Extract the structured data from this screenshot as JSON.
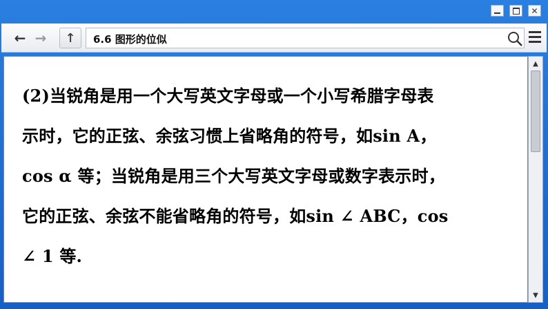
{
  "window": {
    "controls": {
      "minimize": "▭",
      "maximize": "□",
      "close": "✕"
    }
  },
  "toolbar": {
    "back_icon": "←",
    "forward_icon": "→",
    "up_icon": "↑",
    "address": "6.6 图形的位似"
  },
  "content": {
    "lines": [
      "(2)当锐角是用一个大写英文字母或一个小写希腊字母表",
      "示时，它的正弦、余弦习惯上省略角的符号，如sin A，",
      "cos α 等；当锐角是用三个大写英文字母或数字表示时，",
      "它的正弦、余弦不能省略角的符号，如sin ∠ ABC，cos",
      "∠ 1 等."
    ]
  },
  "scrollbar": {
    "up_arrow": "▲",
    "down_arrow": "▼"
  }
}
